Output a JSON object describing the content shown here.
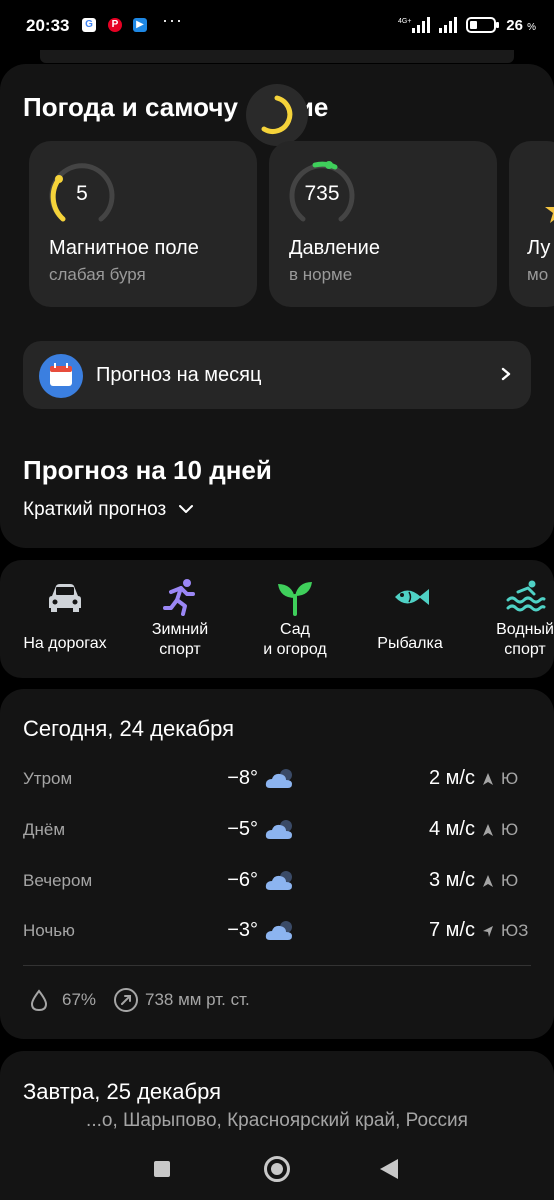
{
  "status_bar": {
    "time": "20:33",
    "more": "···",
    "battery_percent": "26",
    "battery_unit": "%",
    "network": "4G+"
  },
  "wellbeing": {
    "title_left": "Погода и самочу",
    "title_right": "ие",
    "cards": [
      {
        "value": "5",
        "label": "Магнитное поле",
        "status": "слабая буря",
        "gauge_color": "#f5d33a"
      },
      {
        "value": "735",
        "label": "Давление",
        "status": "в норме",
        "gauge_color": "#3fcf5b"
      },
      {
        "label": "Лу",
        "status": "мо"
      }
    ]
  },
  "month_forecast": {
    "label": "Прогноз на месяц"
  },
  "ten_day": {
    "title": "Прогноз на 10 дней",
    "mode_label": "Краткий прогноз"
  },
  "activities": [
    {
      "label": "На дорогах",
      "icon": "car-icon"
    },
    {
      "label": "Зимний\nспорт",
      "icon": "runner-icon"
    },
    {
      "label": "Сад\nи огород",
      "icon": "sprout-icon"
    },
    {
      "label": "Рыбалка",
      "icon": "fish-icon"
    },
    {
      "label": "Водный\nспорт",
      "icon": "waves-icon"
    }
  ],
  "today": {
    "title": "Сегодня, 24 декабря",
    "rows": [
      {
        "period": "Утром",
        "temp": "−8°",
        "wind": "2 м/с",
        "dir": "Ю"
      },
      {
        "period": "Днём",
        "temp": "−5°",
        "wind": "4 м/с",
        "dir": "Ю"
      },
      {
        "period": "Вечером",
        "temp": "−6°",
        "wind": "3 м/с",
        "dir": "Ю"
      },
      {
        "period": "Ночью",
        "temp": "−3°",
        "wind": "7 м/с",
        "dir": "ЮЗ"
      }
    ],
    "humidity": "67%",
    "pressure": "738 мм рт. ст."
  },
  "tomorrow": {
    "title": "Завтра, 25 декабря"
  },
  "location": "...о, Шарыпово, Красноярский край, Россия",
  "colors": {
    "accent_blue": "#3b7fe0",
    "cloud": "#8cb4f0",
    "background": "#000000",
    "panel": "#141414",
    "card": "#262626"
  }
}
